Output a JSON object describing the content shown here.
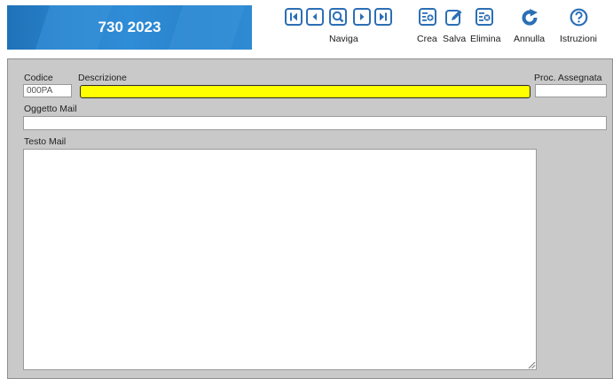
{
  "app": {
    "title": "730 2023"
  },
  "toolbar": {
    "nav_label": "Naviga",
    "crea_label": "Crea",
    "salva_label": "Salva",
    "elimina_label": "Elimina",
    "annulla_label": "Annulla",
    "istruzioni_label": "Istruzioni",
    "accent_color": "#2b6fb5"
  },
  "form": {
    "codice": {
      "label": "Codice",
      "value": "000PA"
    },
    "descrizione": {
      "label": "Descrizione",
      "value": ""
    },
    "proc_assegnata": {
      "label": "Proc. Assegnata",
      "value": ""
    },
    "oggetto_mail": {
      "label": "Oggetto Mail",
      "value": ""
    },
    "testo_mail": {
      "label": "Testo Mail",
      "value": ""
    }
  }
}
